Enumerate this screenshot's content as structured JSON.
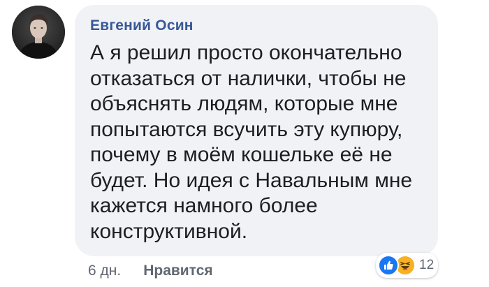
{
  "comment": {
    "author": "Евгений Осин",
    "text": "А я решил просто окончательно отказаться от налички, чтобы не объяснять людям, которые мне попытаются всучить эту купюру, почему в моём кошельке её не будет. Но идея с Навальным мне кажется намного более конструктивной.",
    "time": "6 дн.",
    "like_label": "Нравится",
    "reactions": {
      "icons": [
        "like-icon",
        "haha-icon"
      ],
      "count": "12"
    }
  },
  "colors": {
    "bubble": "#f1f2f5",
    "author": "#385898",
    "text": "#1c1e21",
    "meta": "#606770",
    "like_reaction": "#1877f2",
    "haha_reaction": "#f7b125"
  }
}
